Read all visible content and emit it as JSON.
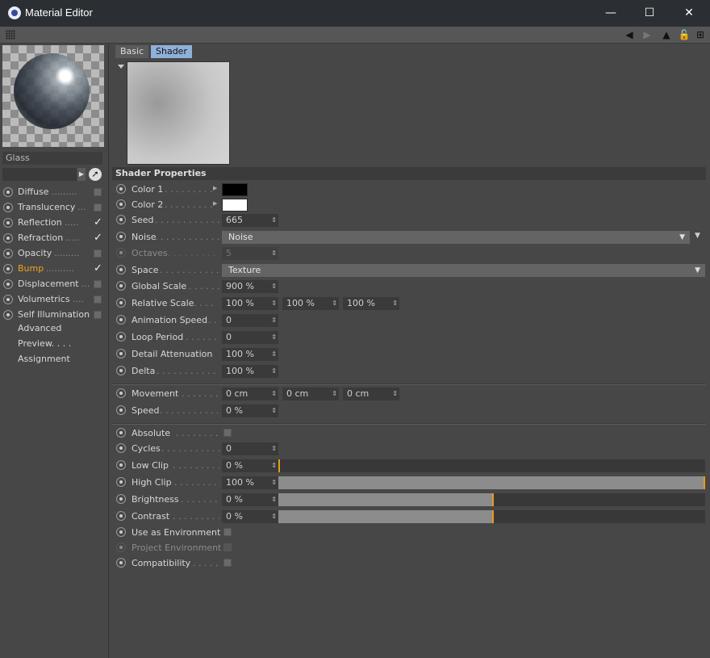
{
  "window": {
    "title": "Material Editor",
    "minimize": "—",
    "maximize": "☐",
    "close": "✕"
  },
  "left": {
    "material_name": "Glass",
    "channels": [
      {
        "label": "Diffuse",
        "dots": ".........",
        "checked": false,
        "active": false
      },
      {
        "label": "Translucency",
        "dots": "...",
        "checked": false,
        "active": false
      },
      {
        "label": "Reflection",
        "dots": ".....",
        "checked": true,
        "active": false
      },
      {
        "label": "Refraction",
        "dots": ".....",
        "checked": true,
        "active": false
      },
      {
        "label": "Opacity",
        "dots": ".........",
        "checked": false,
        "active": false
      },
      {
        "label": "Bump",
        "dots": "..........",
        "checked": true,
        "active": true
      },
      {
        "label": "Displacement",
        "dots": "...",
        "checked": false,
        "active": false
      },
      {
        "label": "Volumetrics",
        "dots": "....",
        "checked": false,
        "active": false
      },
      {
        "label": "Self Illumination",
        "dots": "",
        "checked": false,
        "active": false
      }
    ],
    "extras": [
      "Advanced",
      "Preview. . . .",
      "Assignment"
    ],
    "check_glyph": "✓",
    "active_color": "#f0a01e"
  },
  "tabs": {
    "basic": "Basic",
    "shader": "Shader"
  },
  "shader": {
    "section_title": "Shader Properties",
    "color1_label": "Color 1",
    "color1_value": "#000000",
    "color2_label": "Color 2",
    "color2_value": "#ffffff",
    "seed_label": "Seed",
    "seed_value": "665",
    "noise_label": "Noise",
    "noise_value": "Noise",
    "octaves_label": "Octaves",
    "octaves_value": "5",
    "space_label": "Space",
    "space_value": "Texture",
    "global_scale_label": "Global Scale",
    "global_scale_value": "900 %",
    "relative_scale_label": "Relative Scale",
    "relative_scale_values": [
      "100 %",
      "100 %",
      "100 %"
    ],
    "animation_speed_label": "Animation Speed",
    "animation_speed_value": "0",
    "loop_period_label": "Loop Period",
    "loop_period_value": "0",
    "detail_attenuation_label": "Detail Attenuation",
    "detail_attenuation_value": "100 %",
    "delta_label": "Delta",
    "delta_value": "100 %",
    "movement_label": "Movement",
    "movement_values": [
      "0 cm",
      "0 cm",
      "0 cm"
    ],
    "speed_label": "Speed",
    "speed_value": "0 %",
    "absolute_label": "Absolute",
    "cycles_label": "Cycles",
    "cycles_value": "0",
    "low_clip_label": "Low Clip",
    "low_clip_value": "0 %",
    "low_clip_fraction": 0.0,
    "high_clip_label": "High Clip",
    "high_clip_value": "100 %",
    "high_clip_fraction": 1.0,
    "brightness_label": "Brightness",
    "brightness_value": "0 %",
    "brightness_fraction": 0.5,
    "contrast_label": "Contrast",
    "contrast_value": "0 %",
    "contrast_fraction": 0.5,
    "use_env_label": "Use as Environment",
    "project_env_label": "Project Environment",
    "compat_label": "Compatibility"
  }
}
